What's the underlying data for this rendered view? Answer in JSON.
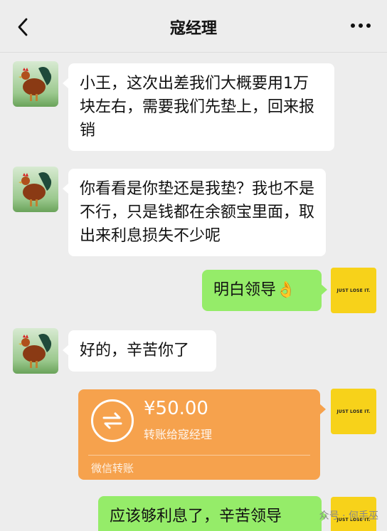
{
  "header": {
    "title": "寇经理",
    "back_icon": "chevron-left-icon",
    "more_icon": "ellipsis-icon"
  },
  "messages": [
    {
      "from": "寇经理",
      "text": "小王，这次出差我们大概要用1万块左右，需要我们先垫上，回来报销"
    },
    {
      "from": "寇经理",
      "text": "你看看是你垫还是我垫？我也不是不行，只是钱都在余额宝里面，取出来利息损失不少呢"
    },
    {
      "from": "self",
      "text": "明白领导",
      "emoji": "👌"
    },
    {
      "from": "寇经理",
      "text": "好的，辛苦你了"
    },
    {
      "from": "self",
      "type": "transfer",
      "amount": "¥50.00",
      "desc": "转账给寇经理",
      "footer": "微信转账"
    },
    {
      "from": "self",
      "text": "应该够利息了，辛苦领导"
    }
  ],
  "self_avatar_text": "JUST LOSE IT.",
  "watermark": "众号 · 何手巫",
  "colors": {
    "bubble_in": "#ffffff",
    "bubble_out": "#95ec69",
    "transfer": "#f6a24d",
    "background": "#ededed"
  }
}
